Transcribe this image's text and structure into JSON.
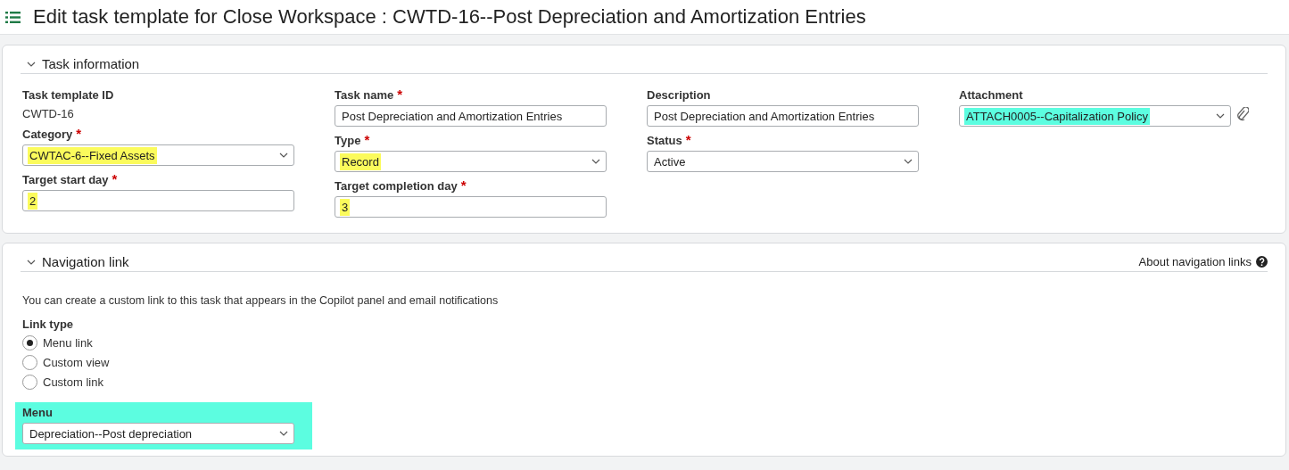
{
  "header": {
    "title": "Edit task template for Close Workspace : CWTD-16--Post Depreciation and Amortization Entries"
  },
  "task_information": {
    "title": "Task information",
    "expanded": true,
    "columns": [
      [
        {
          "kind": "static",
          "label": "Task template ID",
          "value": "CWTD-16"
        },
        {
          "kind": "select",
          "label": "Category",
          "required_mark": "*",
          "value": "CWTAC-6--Fixed Assets",
          "color": "#fbfb5c"
        },
        {
          "kind": "text",
          "label": "Target start day",
          "required_mark": "*",
          "value": "2",
          "color": "#fbfb5c"
        }
      ],
      [
        {
          "kind": "text",
          "label": "Task name",
          "required_mark": "*",
          "value": "Post Depreciation and Amortization Entries"
        },
        {
          "kind": "select",
          "label": "Type",
          "required_mark": "*",
          "value": "Record",
          "color": "#fbfb5c"
        },
        {
          "kind": "text",
          "label": "Target completion day",
          "required_mark": "*",
          "value": "3",
          "color": "#fbfb5c"
        }
      ],
      [
        {
          "kind": "text",
          "label": "Description",
          "value": "Post Depreciation and Amortization Entries"
        },
        {
          "kind": "select",
          "label": "Status",
          "required_mark": "*",
          "value": "Active"
        }
      ],
      [
        {
          "kind": "select",
          "label": "Attachment",
          "value": "ATTACH0005--Capitalization Policy",
          "color": "#5cfde0",
          "attach": true
        }
      ]
    ]
  },
  "navigation_link": {
    "title": "Navigation link",
    "expanded": true,
    "help_link": "About navigation links",
    "info": "You can create a custom link to this task that appears in the Copilot panel and email notifications",
    "link_type": {
      "label": "Link type",
      "options": [
        {
          "label": "Menu link",
          "selected": true
        },
        {
          "label": "Custom view",
          "selected": false
        },
        {
          "label": "Custom link",
          "selected": false
        }
      ]
    },
    "menu": {
      "kind": "select",
      "label": "Menu",
      "value": "Depreciation--Post depreciation",
      "highlight_area": true,
      "color": "#5cfde0"
    }
  }
}
